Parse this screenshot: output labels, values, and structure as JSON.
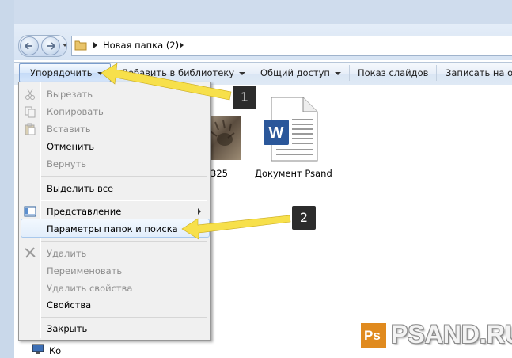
{
  "address": {
    "crumbs": [
      "Новая папка (2)"
    ]
  },
  "toolbar": {
    "organize": "Упорядочить",
    "add_library": "Добавить в библиотеку",
    "share": "Общий доступ",
    "slideshow": "Показ слайдов",
    "burn": "Записать на оп"
  },
  "menu": {
    "cut": "Вырезать",
    "copy": "Копировать",
    "paste": "Вставить",
    "undo": "Отменить",
    "redo": "Вернуть",
    "select_all": "Выделить все",
    "view": "Представление",
    "folder_options": "Параметры папок и поиска",
    "delete": "Удалить",
    "rename": "Переименовать",
    "remove_props": "Удалить свойства",
    "properties": "Свойства",
    "close": "Закрыть"
  },
  "files": [
    {
      "name": "325",
      "icon": "cat-photo-thumbnail"
    },
    {
      "name": "Документ Psand",
      "icon": "word-document-icon"
    }
  ],
  "sidebar_partial": "Ко",
  "callouts": [
    "1",
    "2"
  ],
  "watermark": {
    "ps": "Ps",
    "text": "PSAND.RU"
  },
  "colors": {
    "callout_arrow": "#f7e04b",
    "badge": "#2c2c2c",
    "word_blue": "#2b579a",
    "highlight": "#e2eefb"
  }
}
